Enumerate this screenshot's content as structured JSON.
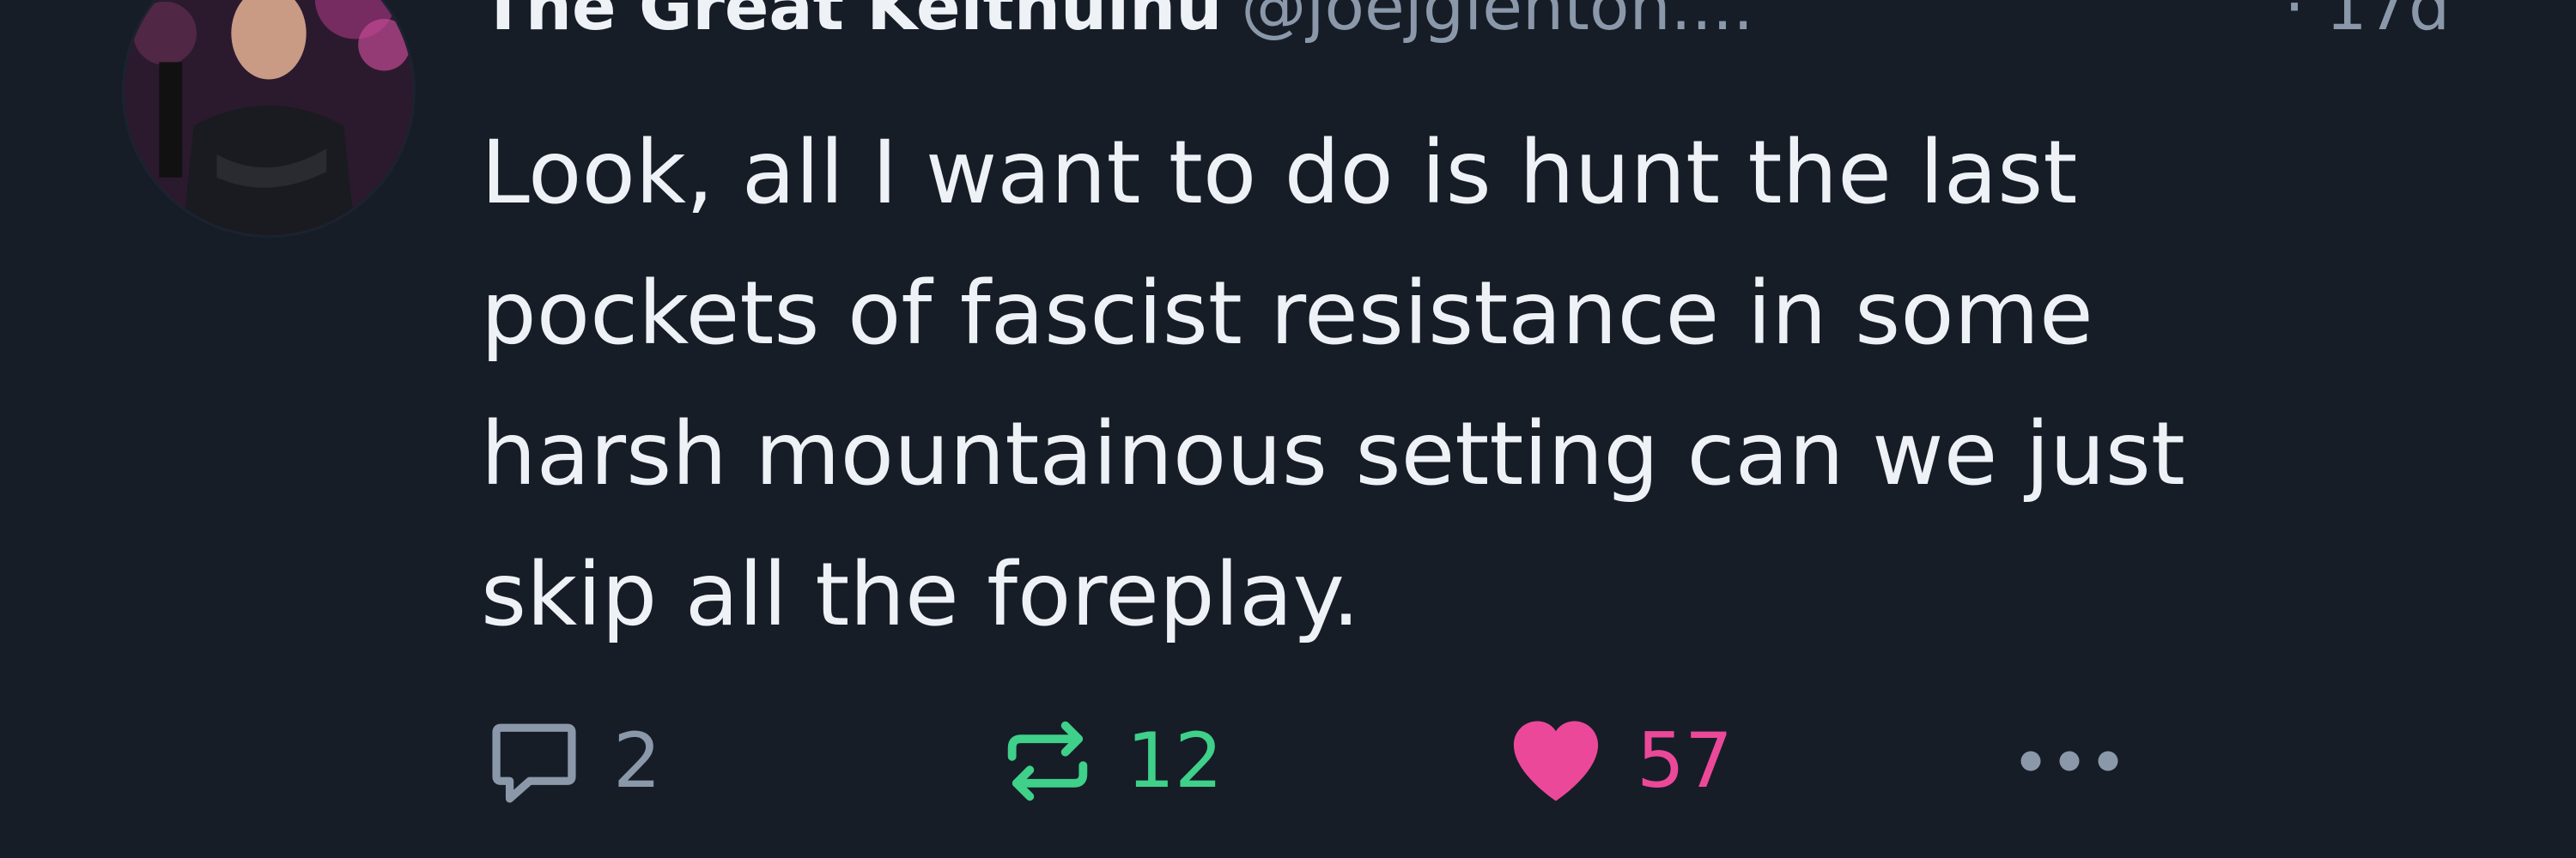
{
  "post": {
    "author": {
      "display_name": "The Great Keithulhu",
      "handle": "@joejglenton...."
    },
    "timestamp": "· 17d",
    "text": "Look, all I want to do is hunt the last\npockets of fascist resistance in some\nharsh mountainous setting can we just\nskip all the foreplay.",
    "actions": {
      "reply_count": "2",
      "repost_count": "12",
      "like_count": "57"
    },
    "icons": {
      "reply": "speech-bubble-icon",
      "repost": "repost-arrows-icon",
      "like": "heart-icon",
      "more": "ellipsis-icon"
    },
    "colors": {
      "background": "#161d27",
      "text": "#eef2f7",
      "muted": "#8a98aa",
      "repost": "#3fd08a",
      "like": "#ec4899"
    }
  }
}
